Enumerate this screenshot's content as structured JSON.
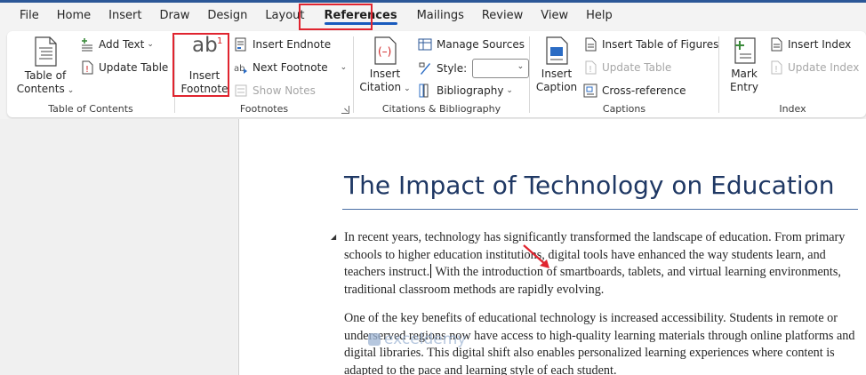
{
  "tabs": [
    {
      "label": "File"
    },
    {
      "label": "Home"
    },
    {
      "label": "Insert"
    },
    {
      "label": "Draw"
    },
    {
      "label": "Design"
    },
    {
      "label": "Layout"
    },
    {
      "label": "References"
    },
    {
      "label": "Mailings"
    },
    {
      "label": "Review"
    },
    {
      "label": "View"
    },
    {
      "label": "Help"
    }
  ],
  "active_tab": "References",
  "ribbon": {
    "toc": {
      "label": "Table of Contents",
      "big_button": {
        "line1": "Table of",
        "line2": "Contents"
      },
      "add_text": "Add Text",
      "update_table": "Update Table"
    },
    "footnotes": {
      "label": "Footnotes",
      "insert_footnote": {
        "line1": "Insert",
        "line2": "Footnote"
      },
      "icon_text": "ab",
      "icon_sup": "1",
      "insert_endnote": "Insert Endnote",
      "next_footnote": "Next Footnote",
      "show_notes": "Show Notes"
    },
    "citations": {
      "label": "Citations & Bibliography",
      "insert_citation": {
        "line1": "Insert",
        "line2": "Citation"
      },
      "manage_sources": "Manage Sources",
      "style_label": "Style:",
      "style_value": "",
      "bibliography": "Bibliography"
    },
    "captions": {
      "label": "Captions",
      "insert_caption": {
        "line1": "Insert",
        "line2": "Caption"
      },
      "insert_table_of_figures": "Insert Table of Figures",
      "update_table": "Update Table",
      "cross_reference": "Cross-reference"
    },
    "index": {
      "label": "Index",
      "mark_entry": {
        "line1": "Mark",
        "line2": "Entry"
      },
      "insert_index": "Insert Index",
      "update_index": "Update Index"
    }
  },
  "document": {
    "title": "The Impact of Technology on Education",
    "para1_before_caret": "In recent years, technology has significantly transformed the landscape of education. From primary schools to higher education institutions, digital tools have enhanced the way students learn, and teachers instruct.",
    "para1_after_caret": " With the introduction of smartboards, tablets, and virtual learning environments, traditional classroom methods are rapidly evolving.",
    "para2": "One of the key benefits of educational technology is increased accessibility. Students in remote or underserved regions now have access to high-quality learning materials through online platforms and digital libraries. This digital shift also enables personalized learning experiences where content is adapted to the pace and learning style of each student.",
    "watermark": "exceldemy"
  },
  "colors": {
    "accent_blue": "#185abd",
    "highlight_red": "#e0242f",
    "title_blue": "#1f3864"
  }
}
